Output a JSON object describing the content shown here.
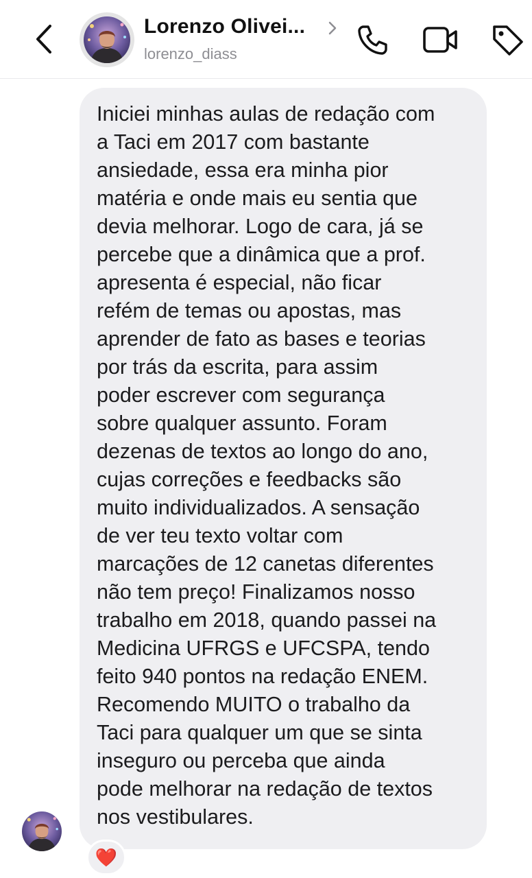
{
  "header": {
    "contact_name": "Lorenzo Olivei...",
    "username": "lorenzo_diass",
    "icons": {
      "back": "chevron-left-icon",
      "profile": "chevron-right-icon",
      "call": "phone-icon",
      "video": "video-camera-icon",
      "tag": "tag-icon"
    }
  },
  "message": {
    "text": "Iniciei minhas aulas de redação com\na Taci em 2017 com bastante\nansiedade, essa era minha pior\nmatéria e onde mais eu sentia que\ndevia melhorar. Logo de cara, já se\npercebe que a dinâmica que a prof.\napresenta é especial, não ficar\nrefém de temas ou apostas, mas\naprender de fato as bases e teorias\npor trás da escrita, para assim\npoder escrever com segurança\nsobre qualquer assunto. Foram\ndezenas de textos ao longo do ano,\ncujas correções e feedbacks são\nmuito individualizados. A sensação\nde ver teu texto voltar com\nmarcações de 12 canetas diferentes\nnão tem preço! Finalizamos nosso\ntrabalho em 2018, quando passei na\nMedicina UFRGS e UFCSPA, tendo\nfeito 940 pontos na redação ENEM.\nRecomendo MUITO o trabalho da\nTaci para qualquer um que se sinta\ninseguro ou perceba que ainda\npode melhorar na redação de textos\nnos vestibulares.",
    "reaction": "❤️",
    "bubble_color": "#efeff2"
  }
}
